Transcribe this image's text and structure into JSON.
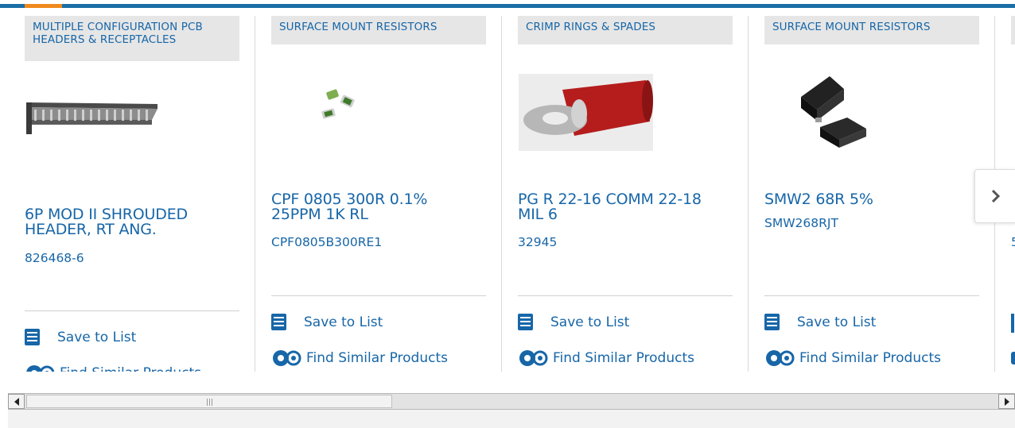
{
  "colors": {
    "link": "#1766a8",
    "accent": "#f08a1c",
    "bar": "#1a6ea6",
    "category_bg": "#e6e6e6"
  },
  "cards": [
    {
      "category": "MULTIPLE CONFIGURATION PCB HEADERS & RECEPTACLES",
      "title": "6P MOD II SHROUDED HEADER, RT ANG.",
      "part_number": "826468-6",
      "save_label": "Save to List",
      "similar_label": "Find Similar Products",
      "image": "pcb-header-image"
    },
    {
      "category": "SURFACE MOUNT RESISTORS",
      "title": "CPF 0805 300R 0.1% 25PPM 1K RL",
      "part_number": "CPF0805B300RE1",
      "save_label": "Save to List",
      "similar_label": "Find Similar Products",
      "image": "chip-resistor-image"
    },
    {
      "category": "CRIMP RINGS & SPADES",
      "title": "PG R 22-16 COMM 22-18 MIL 6",
      "part_number": "32945",
      "save_label": "Save to List",
      "similar_label": "Find Similar Products",
      "image": "ring-terminal-image"
    },
    {
      "category": "SURFACE MOUNT RESISTORS",
      "title": "SMW2 68R 5%",
      "part_number": "SMW268RJT",
      "save_label": "Save to List",
      "similar_label": "Find Similar Products",
      "image": "power-resistor-image"
    }
  ],
  "next_icon": "chevron-right-icon",
  "partial_card": {
    "part_number_fragment": "5"
  },
  "scrollbar": {
    "left_icon": "arrow-left-icon",
    "right_icon": "arrow-right-icon"
  }
}
